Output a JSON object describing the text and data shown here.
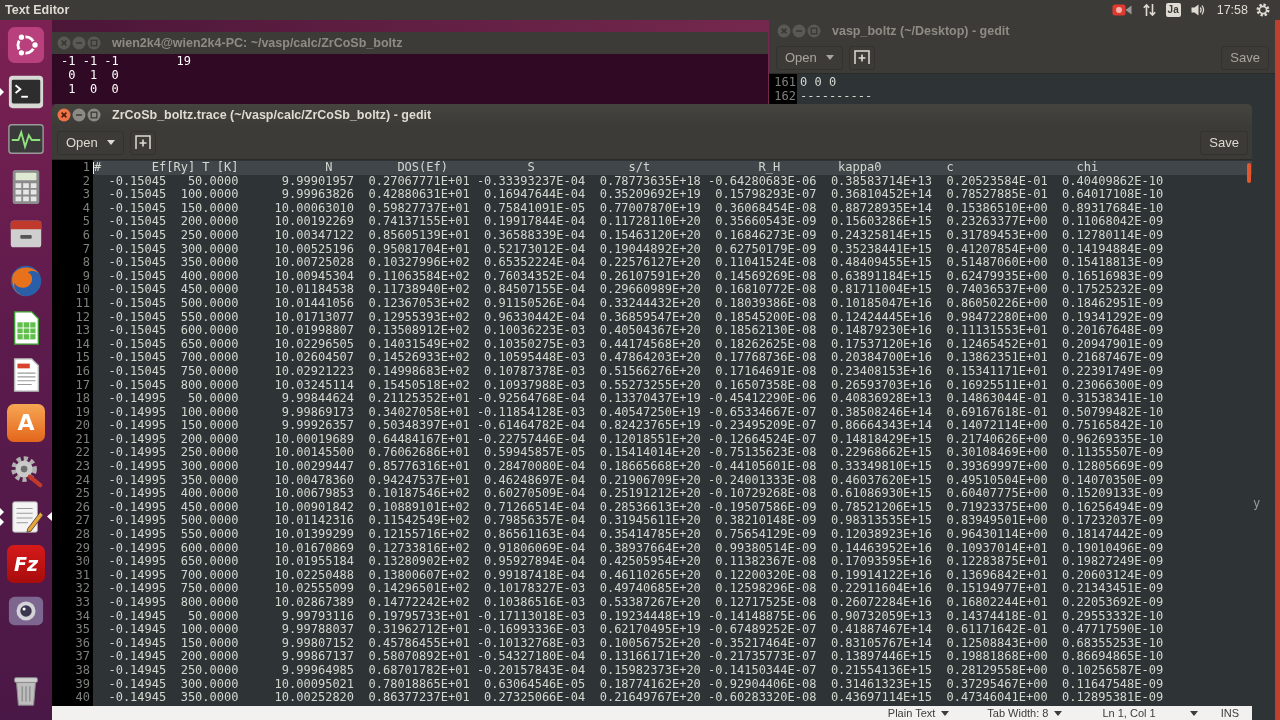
{
  "top_panel": {
    "app_title": "Text Editor",
    "keyboard_layout": "Ja",
    "clock": "17:58"
  },
  "launcher": {
    "items": [
      {
        "kind": "dash",
        "running": false,
        "multiple_windows": false,
        "focused": false
      },
      {
        "kind": "terminal",
        "running": true,
        "multiple_windows": false,
        "focused": false
      },
      {
        "kind": "monitor",
        "running": false,
        "multiple_windows": false,
        "focused": false
      },
      {
        "kind": "calculator",
        "running": false,
        "multiple_windows": false,
        "focused": false
      },
      {
        "kind": "drawer",
        "running": false,
        "multiple_windows": false,
        "focused": false
      },
      {
        "kind": "browser",
        "running": false,
        "multiple_windows": false,
        "focused": false
      },
      {
        "kind": "spreadsheet",
        "running": false,
        "multiple_windows": false,
        "focused": false
      },
      {
        "kind": "document",
        "running": false,
        "multiple_windows": false,
        "focused": false
      },
      {
        "kind": "store",
        "glyph": "A",
        "running": false,
        "multiple_windows": false,
        "focused": false
      },
      {
        "kind": "settings",
        "running": false,
        "multiple_windows": false,
        "focused": false
      },
      {
        "kind": "text_editor",
        "running": true,
        "multiple_windows": true,
        "focused": true
      },
      {
        "kind": "ftp",
        "glyph": "Fz",
        "running": false,
        "multiple_windows": false,
        "focused": false
      },
      {
        "kind": "camera",
        "running": false,
        "multiple_windows": false,
        "focused": false
      },
      {
        "kind": "trash",
        "running": false,
        "multiple_windows": false,
        "focused": false
      }
    ]
  },
  "terminal_window": {
    "focused": false,
    "title": "wien2k4@wien2k4-PC: ~/vasp/calc/ZrCoSb_boltz",
    "lines": [
      "-1 -1 -1        19",
      " 0  1  0",
      " 1  0  0"
    ]
  },
  "desktop_gedit_window": {
    "focused": false,
    "title": "vasp_boltz (~/Desktop) - gedit",
    "open_button": "Open",
    "save_button": "Save",
    "lines": [
      {
        "number": "161",
        "text": "0 0 0"
      },
      {
        "number": "162",
        "text": "----------"
      }
    ],
    "clipped_text": "y"
  },
  "trace_window": {
    "focused": true,
    "title": "ZrCoSb_boltz.trace (~/vasp/calc/ZrCoSb_boltz) - gedit",
    "open_button": "Open",
    "save_button": "Save",
    "header": {
      "number": "1",
      "current": true,
      "labels": [
        "#",
        "Ef[Ry]",
        "T [K]",
        "N",
        "DOS(Ef)",
        "S",
        "s/t",
        "R_H",
        "kappa0",
        "c",
        "chi"
      ]
    },
    "rows": [
      {
        "number": "2",
        "current": false,
        "values": [
          "-0.15045",
          "50.0000",
          "9.99901957",
          "0.27067771E+01",
          "-0.33393237E-04",
          "0.78773635E+18",
          "-0.64280683E-06",
          "0.38583714E+13",
          "0.20523584E-01",
          "0.40409862E-10"
        ]
      },
      {
        "number": "3",
        "current": false,
        "values": [
          "-0.15045",
          "100.0000",
          "9.99963826",
          "0.42880631E+01",
          "0.16947644E-04",
          "0.35209692E+19",
          "0.15798293E-07",
          "0.36810452E+14",
          "0.78527885E-01",
          "0.64017108E-10"
        ]
      },
      {
        "number": "4",
        "current": false,
        "values": [
          "-0.15045",
          "150.0000",
          "10.00063010",
          "0.59827737E+01",
          "0.75841091E-05",
          "0.77007870E+19",
          "0.36068454E-08",
          "0.88728935E+14",
          "0.15386510E+00",
          "0.89317684E-10"
        ]
      },
      {
        "number": "5",
        "current": false,
        "values": [
          "-0.15045",
          "200.0000",
          "10.00192269",
          "0.74137155E+01",
          "0.19917844E-04",
          "0.11728110E+20",
          "0.35660543E-09",
          "0.15603286E+15",
          "0.23263377E+00",
          "0.11068042E-09"
        ]
      },
      {
        "number": "6",
        "current": false,
        "values": [
          "-0.15045",
          "250.0000",
          "10.00347122",
          "0.85605139E+01",
          "0.36588339E-04",
          "0.15463120E+20",
          "0.16846273E-09",
          "0.24325814E+15",
          "0.31789453E+00",
          "0.12780114E-09"
        ]
      },
      {
        "number": "7",
        "current": false,
        "values": [
          "-0.15045",
          "300.0000",
          "10.00525196",
          "0.95081704E+01",
          "0.52173012E-04",
          "0.19044892E+20",
          "0.62750179E-09",
          "0.35238441E+15",
          "0.41207854E+00",
          "0.14194884E-09"
        ]
      },
      {
        "number": "8",
        "current": false,
        "values": [
          "-0.15045",
          "350.0000",
          "10.00725028",
          "0.10327996E+02",
          "0.65352224E-04",
          "0.22576127E+20",
          "0.11041524E-08",
          "0.48409455E+15",
          "0.51487060E+00",
          "0.15418813E-09"
        ]
      },
      {
        "number": "9",
        "current": false,
        "values": [
          "-0.15045",
          "400.0000",
          "10.00945304",
          "0.11063584E+02",
          "0.76034352E-04",
          "0.26107591E+20",
          "0.14569269E-08",
          "0.63891184E+15",
          "0.62479935E+00",
          "0.16516983E-09"
        ]
      },
      {
        "number": "10",
        "current": false,
        "values": [
          "-0.15045",
          "450.0000",
          "10.01184538",
          "0.11738940E+02",
          "0.84507155E-04",
          "0.29660989E+20",
          "0.16810772E-08",
          "0.81711004E+15",
          "0.74036537E+00",
          "0.17525232E-09"
        ]
      },
      {
        "number": "11",
        "current": false,
        "values": [
          "-0.15045",
          "500.0000",
          "10.01441056",
          "0.12367053E+02",
          "0.91150526E-04",
          "0.33244432E+20",
          "0.18039386E-08",
          "0.10185047E+16",
          "0.86050226E+00",
          "0.18462951E-09"
        ]
      },
      {
        "number": "12",
        "current": false,
        "values": [
          "-0.15045",
          "550.0000",
          "10.01713077",
          "0.12955393E+02",
          "0.96330442E-04",
          "0.36859547E+20",
          "0.18545200E-08",
          "0.12424445E+16",
          "0.98472280E+00",
          "0.19341292E-09"
        ]
      },
      {
        "number": "13",
        "current": false,
        "values": [
          "-0.15045",
          "600.0000",
          "10.01998807",
          "0.13508912E+02",
          "0.10036223E-03",
          "0.40504367E+20",
          "0.18562130E-08",
          "0.14879230E+16",
          "0.11131553E+01",
          "0.20167648E-09"
        ]
      },
      {
        "number": "14",
        "current": false,
        "values": [
          "-0.15045",
          "650.0000",
          "10.02296505",
          "0.14031549E+02",
          "0.10350275E-03",
          "0.44174568E+20",
          "0.18262625E-08",
          "0.17537120E+16",
          "0.12465452E+01",
          "0.20947901E-09"
        ]
      },
      {
        "number": "15",
        "current": false,
        "values": [
          "-0.15045",
          "700.0000",
          "10.02604507",
          "0.14526933E+02",
          "0.10595448E-03",
          "0.47864203E+20",
          "0.17768736E-08",
          "0.20384700E+16",
          "0.13862351E+01",
          "0.21687467E-09"
        ]
      },
      {
        "number": "16",
        "current": false,
        "values": [
          "-0.15045",
          "750.0000",
          "10.02921223",
          "0.14998683E+02",
          "0.10787378E-03",
          "0.51566276E+20",
          "0.17164691E-08",
          "0.23408153E+16",
          "0.15341171E+01",
          "0.22391749E-09"
        ]
      },
      {
        "number": "17",
        "current": false,
        "values": [
          "-0.15045",
          "800.0000",
          "10.03245114",
          "0.15450518E+02",
          "0.10937988E-03",
          "0.55273255E+20",
          "0.16507358E-08",
          "0.26593703E+16",
          "0.16925511E+01",
          "0.23066300E-09"
        ]
      },
      {
        "number": "18",
        "current": false,
        "values": [
          "-0.14995",
          "50.0000",
          "9.99844624",
          "0.21125352E+01",
          "-0.92564768E-04",
          "0.13370437E+19",
          "-0.45412290E-06",
          "0.40836928E+13",
          "0.14863044E-01",
          "0.31538341E-10"
        ]
      },
      {
        "number": "19",
        "current": false,
        "values": [
          "-0.14995",
          "100.0000",
          "9.99869173",
          "0.34027058E+01",
          "-0.11854128E-03",
          "0.40547250E+19",
          "-0.65334667E-07",
          "0.38508246E+14",
          "0.69167618E-01",
          "0.50799482E-10"
        ]
      },
      {
        "number": "20",
        "current": false,
        "values": [
          "-0.14995",
          "150.0000",
          "9.99926357",
          "0.50348397E+01",
          "-0.61464782E-04",
          "0.82423765E+19",
          "-0.23495209E-07",
          "0.86664343E+14",
          "0.14072114E+00",
          "0.75165842E-10"
        ]
      },
      {
        "number": "21",
        "current": false,
        "values": [
          "-0.14995",
          "200.0000",
          "10.00019689",
          "0.64484167E+01",
          "-0.22757446E-04",
          "0.12018551E+20",
          "-0.12664524E-07",
          "0.14818429E+15",
          "0.21740626E+00",
          "0.96269335E-10"
        ]
      },
      {
        "number": "22",
        "current": false,
        "values": [
          "-0.14995",
          "250.0000",
          "10.00145500",
          "0.76062686E+01",
          "0.59945857E-05",
          "0.15414014E+20",
          "-0.75135623E-08",
          "0.22968662E+15",
          "0.30108469E+00",
          "0.11355507E-09"
        ]
      },
      {
        "number": "23",
        "current": false,
        "values": [
          "-0.14995",
          "300.0000",
          "10.00299447",
          "0.85776316E+01",
          "0.28470080E-04",
          "0.18665668E+20",
          "-0.44105601E-08",
          "0.33349810E+15",
          "0.39369997E+00",
          "0.12805669E-09"
        ]
      },
      {
        "number": "24",
        "current": false,
        "values": [
          "-0.14995",
          "350.0000",
          "10.00478360",
          "0.94247537E+01",
          "0.46248697E-04",
          "0.21906709E+20",
          "-0.24001333E-08",
          "0.46037620E+15",
          "0.49510504E+00",
          "0.14070350E-09"
        ]
      },
      {
        "number": "25",
        "current": false,
        "values": [
          "-0.14995",
          "400.0000",
          "10.00679853",
          "0.10187546E+02",
          "0.60270509E-04",
          "0.25191212E+20",
          "-0.10729268E-08",
          "0.61086930E+15",
          "0.60407775E+00",
          "0.15209133E-09"
        ]
      },
      {
        "number": "26",
        "current": false,
        "values": [
          "-0.14995",
          "450.0000",
          "10.00901842",
          "0.10889101E+02",
          "0.71266514E-04",
          "0.28536613E+20",
          "-0.19507586E-09",
          "0.78521206E+15",
          "0.71923375E+00",
          "0.16256494E-09"
        ]
      },
      {
        "number": "27",
        "current": false,
        "values": [
          "-0.14995",
          "500.0000",
          "10.01142316",
          "0.11542549E+02",
          "0.79856357E-04",
          "0.31945611E+20",
          "0.38210148E-09",
          "0.98313535E+15",
          "0.83949501E+00",
          "0.17232037E-09"
        ]
      },
      {
        "number": "28",
        "current": false,
        "values": [
          "-0.14995",
          "550.0000",
          "10.01399299",
          "0.12155716E+02",
          "0.86561163E-04",
          "0.35414785E+20",
          "0.75654129E-09",
          "0.12038923E+16",
          "0.96430114E+00",
          "0.18147442E-09"
        ]
      },
      {
        "number": "29",
        "current": false,
        "values": [
          "-0.14995",
          "600.0000",
          "10.01670869",
          "0.12733816E+02",
          "0.91806069E-04",
          "0.38937664E+20",
          "0.99380514E-09",
          "0.14463952E+16",
          "0.10937014E+01",
          "0.19010496E-09"
        ]
      },
      {
        "number": "30",
        "current": false,
        "values": [
          "-0.14995",
          "650.0000",
          "10.01955184",
          "0.13280902E+02",
          "0.95927894E-04",
          "0.42505954E+20",
          "0.11382367E-08",
          "0.17093595E+16",
          "0.12283875E+01",
          "0.19827249E-09"
        ]
      },
      {
        "number": "31",
        "current": false,
        "values": [
          "-0.14995",
          "700.0000",
          "10.02250488",
          "0.13800607E+02",
          "0.99187418E-04",
          "0.46110265E+20",
          "0.12200320E-08",
          "0.19914122E+16",
          "0.13696842E+01",
          "0.20603124E-09"
        ]
      },
      {
        "number": "32",
        "current": false,
        "values": [
          "-0.14995",
          "750.0000",
          "10.02555099",
          "0.14296501E+02",
          "0.10178327E-03",
          "0.49740685E+20",
          "0.12598296E-08",
          "0.22911604E+16",
          "0.15194977E+01",
          "0.21343451E-09"
        ]
      },
      {
        "number": "33",
        "current": false,
        "values": [
          "-0.14995",
          "800.0000",
          "10.02867389",
          "0.14772242E+02",
          "0.10386516E-03",
          "0.53387267E+20",
          "0.12717525E-08",
          "0.26072284E+16",
          "0.16802244E+01",
          "0.22053692E-09"
        ]
      },
      {
        "number": "34",
        "current": false,
        "values": [
          "-0.14945",
          "50.0000",
          "9.99793116",
          "0.19795733E+01",
          "-0.17113018E-03",
          "0.19234448E+19",
          "-0.14148875E-06",
          "0.90732059E+13",
          "0.14374418E-01",
          "0.29553332E-10"
        ]
      },
      {
        "number": "35",
        "current": false,
        "values": [
          "-0.14945",
          "100.0000",
          "9.99788037",
          "0.31962712E+01",
          "-0.16993336E-03",
          "0.62170495E+19",
          "-0.67489252E-07",
          "0.41887467E+14",
          "0.61171642E-01",
          "0.47717590E-10"
        ]
      },
      {
        "number": "36",
        "current": false,
        "values": [
          "-0.14945",
          "150.0000",
          "9.99807152",
          "0.45786455E+01",
          "-0.10132768E-03",
          "0.10056752E+20",
          "-0.35217464E-07",
          "0.83105767E+14",
          "0.12508843E+00",
          "0.68355253E-10"
        ]
      },
      {
        "number": "37",
        "current": false,
        "values": [
          "-0.14945",
          "200.0000",
          "9.99867137",
          "0.58070892E+01",
          "-0.54327180E-04",
          "0.13166171E+20",
          "-0.21735773E-07",
          "0.13897446E+15",
          "0.19881868E+00",
          "0.86694865E-10"
        ]
      },
      {
        "number": "38",
        "current": false,
        "values": [
          "-0.14945",
          "250.0000",
          "9.99964985",
          "0.68701782E+01",
          "-0.20157843E-04",
          "0.15982373E+20",
          "-0.14150344E-07",
          "0.21554136E+15",
          "0.28129558E+00",
          "0.10256587E-09"
        ]
      },
      {
        "number": "39",
        "current": false,
        "values": [
          "-0.14945",
          "300.0000",
          "10.00095021",
          "0.78018865E+01",
          "0.63064546E-05",
          "0.18774162E+20",
          "-0.92904406E-08",
          "0.31461323E+15",
          "0.37295467E+00",
          "0.11647548E-09"
        ]
      },
      {
        "number": "40",
        "current": false,
        "values": [
          "-0.14945",
          "350.0000",
          "10.00252820",
          "0.86377237E+01",
          "0.27325066E-04",
          "0.21649767E+20",
          "-0.60283320E-08",
          "0.43697114E+15",
          "0.47346041E+00",
          "0.12895381E-09"
        ]
      }
    ],
    "status_bar": {
      "language": "Plain Text",
      "tab_width": "Tab Width: 8",
      "position": "Ln 1, Col 1",
      "mode": "INS"
    }
  }
}
